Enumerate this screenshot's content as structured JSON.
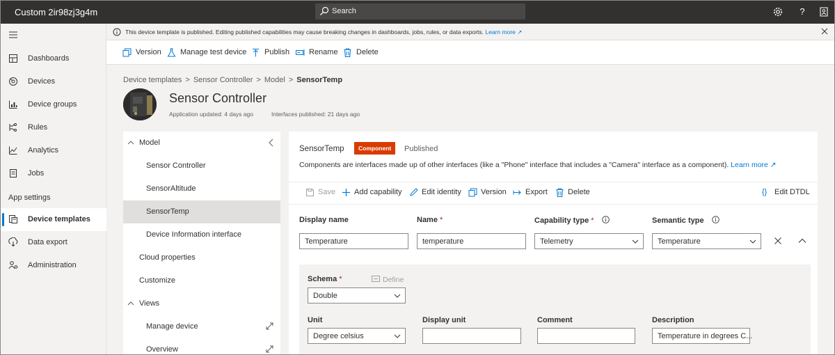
{
  "app": {
    "title": "Custom 2ir98zj3g4m"
  },
  "search": {
    "placeholder": "Search"
  },
  "topbar_icons": [
    "gear-icon",
    "help-icon",
    "account-icon"
  ],
  "nav": {
    "items": [
      {
        "label": "Dashboards",
        "icon": "dashboard-icon"
      },
      {
        "label": "Devices",
        "icon": "devices-icon"
      },
      {
        "label": "Device groups",
        "icon": "device-groups-icon"
      },
      {
        "label": "Rules",
        "icon": "rules-icon"
      },
      {
        "label": "Analytics",
        "icon": "analytics-icon"
      },
      {
        "label": "Jobs",
        "icon": "jobs-icon"
      }
    ],
    "section": "App settings",
    "settings_items": [
      {
        "label": "Device templates",
        "icon": "device-templates-icon",
        "active": true
      },
      {
        "label": "Data export",
        "icon": "data-export-icon"
      },
      {
        "label": "Administration",
        "icon": "administration-icon"
      }
    ]
  },
  "banner": {
    "text": "This device template is published. Editing published capabilities may cause breaking changes in dashboards, jobs, rules, or data exports.",
    "link": "Learn more"
  },
  "commands": {
    "version": "Version",
    "manage_test_device": "Manage test device",
    "publish": "Publish",
    "rename": "Rename",
    "delete": "Delete"
  },
  "breadcrumb": {
    "items": [
      "Device templates",
      "Sensor Controller",
      "Model"
    ],
    "current": "SensorTemp"
  },
  "header": {
    "title": "Sensor Controller",
    "app_updated": "Application updated: 4 days ago",
    "interfaces_published": "Interfaces published: 21 days ago"
  },
  "tree": {
    "model": "Model",
    "children": [
      "Sensor Controller",
      "SensorAltitude",
      "SensorTemp",
      "Device Information interface"
    ],
    "selected": "SensorTemp",
    "cloud_properties": "Cloud properties",
    "customize": "Customize",
    "views": "Views",
    "view_items": [
      "Manage device",
      "Overview"
    ]
  },
  "editor": {
    "title": "SensorTemp",
    "badge": "Component",
    "status": "Published",
    "description": "Components are interfaces made up of other interfaces (like a \"Phone\" interface that includes a \"Camera\" interface as a component).",
    "learn_more": "Learn more",
    "commands": {
      "save": "Save",
      "add_capability": "Add capability",
      "edit_identity": "Edit identity",
      "version": "Version",
      "export": "Export",
      "delete": "Delete",
      "edit_dtdl": "Edit DTDL"
    },
    "fields": {
      "display_name": {
        "label": "Display name",
        "value": "Temperature"
      },
      "name": {
        "label": "Name",
        "value": "temperature"
      },
      "capability_type": {
        "label": "Capability type",
        "value": "Telemetry"
      },
      "semantic_type": {
        "label": "Semantic type",
        "value": "Temperature"
      }
    },
    "detail": {
      "schema": {
        "label": "Schema",
        "value": "Double"
      },
      "define": "Define",
      "unit": {
        "label": "Unit",
        "value": "Degree celsius"
      },
      "display_unit": {
        "label": "Display unit",
        "value": ""
      },
      "comment": {
        "label": "Comment",
        "value": ""
      },
      "description": {
        "label": "Description",
        "value": "Temperature in degrees C..."
      }
    }
  },
  "colors": {
    "accent": "#0078d4",
    "badge": "#d83b01",
    "topbar": "#323130"
  }
}
